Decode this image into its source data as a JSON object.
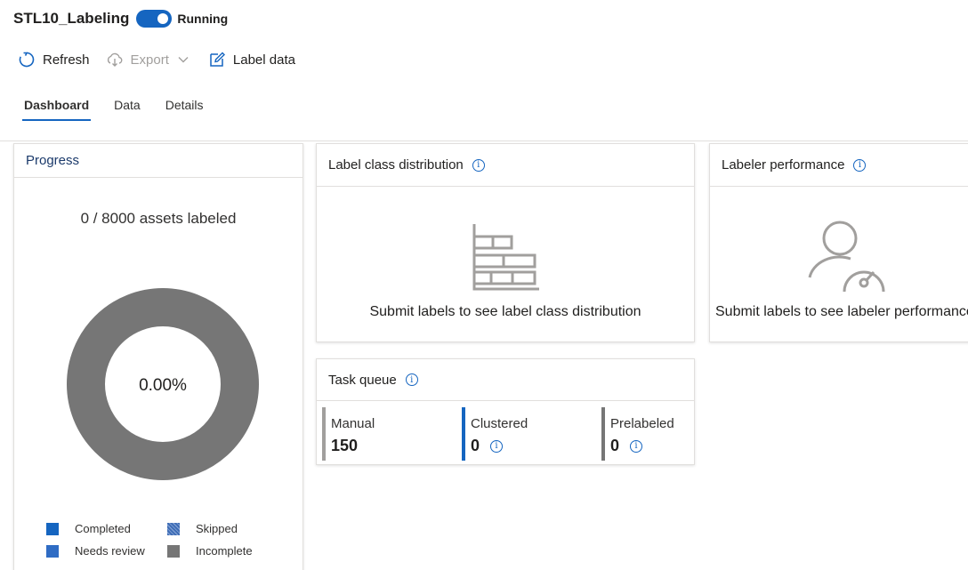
{
  "header": {
    "title": "STL10_Labeling",
    "status_label": "Running"
  },
  "toolbar": {
    "refresh_label": "Refresh",
    "export_label": "Export",
    "label_data_label": "Label data"
  },
  "tabs": [
    {
      "label": "Dashboard",
      "active": true
    },
    {
      "label": "Data",
      "active": false
    },
    {
      "label": "Details",
      "active": false
    }
  ],
  "progress": {
    "title": "Progress",
    "assets_text": "0 / 8000 assets labeled",
    "percent_text": "0.00%",
    "labeled": 0,
    "total": 8000,
    "legend": [
      {
        "label": "Completed",
        "color": "#1565c0"
      },
      {
        "label": "Skipped",
        "color": "#3f6db6"
      },
      {
        "label": "Needs review",
        "color": "#2f6cc4"
      },
      {
        "label": "Incomplete",
        "color": "#767676"
      }
    ]
  },
  "label_class_distribution": {
    "title": "Label class distribution",
    "empty_text": "Submit labels to see label class distribution"
  },
  "labeler_performance": {
    "title": "Labeler performance",
    "empty_text": "Submit labels to see labeler performance"
  },
  "task_queue": {
    "title": "Task queue",
    "items": [
      {
        "label": "Manual",
        "value": "150",
        "color": "#a19f9d"
      },
      {
        "label": "Clustered",
        "value": "0",
        "color": "#1565c0"
      },
      {
        "label": "Prelabeled",
        "value": "0",
        "color": "#767676"
      }
    ]
  },
  "colors": {
    "accent": "#1565c0",
    "donut_incomplete": "#767676"
  }
}
